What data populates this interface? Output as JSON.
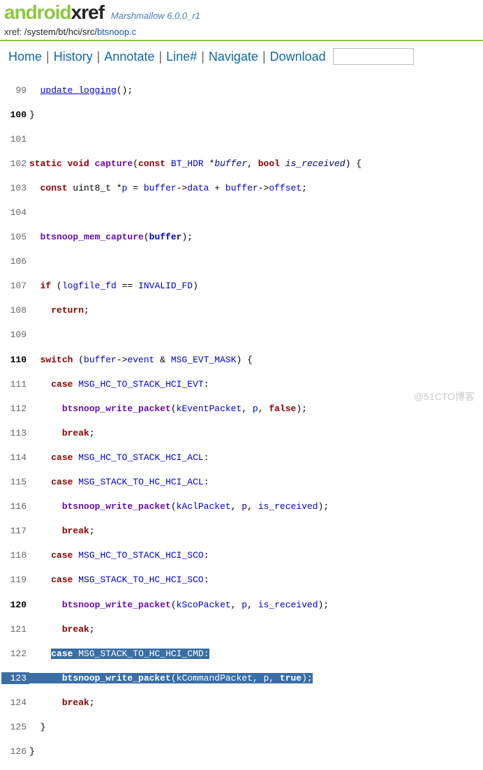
{
  "logo": {
    "left": "android",
    "right": "xref",
    "sub": "Marshmallow 6.0.0_r1"
  },
  "xref": {
    "prefix": "xref: ",
    "path": "/system/bt/hci/src/",
    "file": "btsnoop.c"
  },
  "nav": {
    "home": "Home",
    "history": "History",
    "annotate": "Annotate",
    "line": "Line#",
    "navigate": "Navigate",
    "download": "Download"
  },
  "watermark": "@51CTO博客",
  "code": {
    "l99_cut": "update_logging",
    "l99_tail": "();",
    "l100": "}",
    "l102_1": "static",
    "l102_2": " ",
    "l102_3": "void",
    "l102_4": " ",
    "l102_5": "capture",
    "l102_6": "(",
    "l102_7": "const",
    "l102_8": " ",
    "l102_9": "BT_HDR",
    "l102_10": " *",
    "l102_11": "buffer",
    "l102_12": ", ",
    "l102_13": "bool",
    "l102_14": " ",
    "l102_15": "is_received",
    "l102_16": ") {",
    "l103_1": "  ",
    "l103_2": "const",
    "l103_3": " uint8_t *",
    "l103_4": "p",
    "l103_5": " = ",
    "l103_6": "buffer",
    "l103_7": "->",
    "l103_8": "data",
    "l103_9": " + ",
    "l103_10": "buffer",
    "l103_11": "->",
    "l103_12": "offset",
    "l103_13": ";",
    "l105_1": "  ",
    "l105_2": "btsnoop_mem_capture",
    "l105_3": "(",
    "l105_4": "buffer",
    "l105_5": ");",
    "l107_1": "  ",
    "l107_2": "if",
    "l107_3": " (",
    "l107_4": "logfile_fd",
    "l107_5": " == ",
    "l107_6": "INVALID_FD",
    "l107_7": ")",
    "l108_1": "    ",
    "l108_2": "return",
    "l108_3": ";",
    "l110_1": "  ",
    "l110_2": "switch",
    "l110_3": " (",
    "l110_4": "buffer",
    "l110_5": "->",
    "l110_6": "event",
    "l110_7": " & ",
    "l110_8": "MSG_EVT_MASK",
    "l110_9": ") {",
    "l111_1": "    ",
    "l111_2": "case",
    "l111_3": " ",
    "l111_4": "MSG_HC_TO_STACK_HCI_EVT",
    "l111_5": ":",
    "l112_1": "      ",
    "l112_2": "btsnoop_write_packet",
    "l112_3": "(",
    "l112_4": "kEventPacket",
    "l112_5": ", ",
    "l112_6": "p",
    "l112_7": ", ",
    "l112_8": "false",
    "l112_9": ");",
    "l113_1": "      ",
    "l113_2": "break",
    "l113_3": ";",
    "l114_1": "    ",
    "l114_2": "case",
    "l114_3": " ",
    "l114_4": "MSG_HC_TO_STACK_HCI_ACL",
    "l114_5": ":",
    "l115_1": "    ",
    "l115_2": "case",
    "l115_3": " ",
    "l115_4": "MSG_STACK_TO_HC_HCI_ACL",
    "l115_5": ":",
    "l116_1": "      ",
    "l116_2": "btsnoop_write_packet",
    "l116_3": "(",
    "l116_4": "kAclPacket",
    "l116_5": ", ",
    "l116_6": "p",
    "l116_7": ", ",
    "l116_8": "is_received",
    "l116_9": ");",
    "l117_1": "      ",
    "l117_2": "break",
    "l117_3": ";",
    "l118_1": "    ",
    "l118_2": "case",
    "l118_3": " ",
    "l118_4": "MSG_HC_TO_STACK_HCI_SCO",
    "l118_5": ":",
    "l119_1": "    ",
    "l119_2": "case",
    "l119_3": " ",
    "l119_4": "MSG_STACK_TO_HC_HCI_SCO",
    "l119_5": ":",
    "l120_1": "      ",
    "l120_2": "btsnoop_write_packet",
    "l120_3": "(",
    "l120_4": "kScoPacket",
    "l120_5": ", ",
    "l120_6": "p",
    "l120_7": ", ",
    "l120_8": "is_received",
    "l120_9": ");",
    "l121_1": "      ",
    "l121_2": "break",
    "l121_3": ";",
    "l122_1": "    ",
    "l122_2": "case",
    "l122_3": " ",
    "l122_4": "MSG_STACK_TO_HC_HCI_CMD",
    "l122_5": ":",
    "l123_1": "      ",
    "l123_2": "btsnoop_write_packet",
    "l123_3": "(",
    "l123_4": "kCommandPacket",
    "l123_5": ", ",
    "l123_6": "p",
    "l123_7": ", ",
    "l123_8": "true",
    "l123_9": ");",
    "l124_1": "      ",
    "l124_2": "break",
    "l124_3": ";",
    "l125": "  }",
    "l126": "}"
  },
  "ln": {
    "99": "99",
    "100": "100",
    "101": "101",
    "102": "102",
    "103": "103",
    "104": "104",
    "105": "105",
    "106": "106",
    "107": "107",
    "108": "108",
    "109": "109",
    "110": "110",
    "111": "111",
    "112": "112",
    "113": "113",
    "114": "114",
    "115": "115",
    "116": "116",
    "117": "117",
    "118": "118",
    "119": "119",
    "120": "120",
    "121": "121",
    "122": "122",
    "123": "123",
    "124": "124",
    "125": "125",
    "126": "126"
  }
}
